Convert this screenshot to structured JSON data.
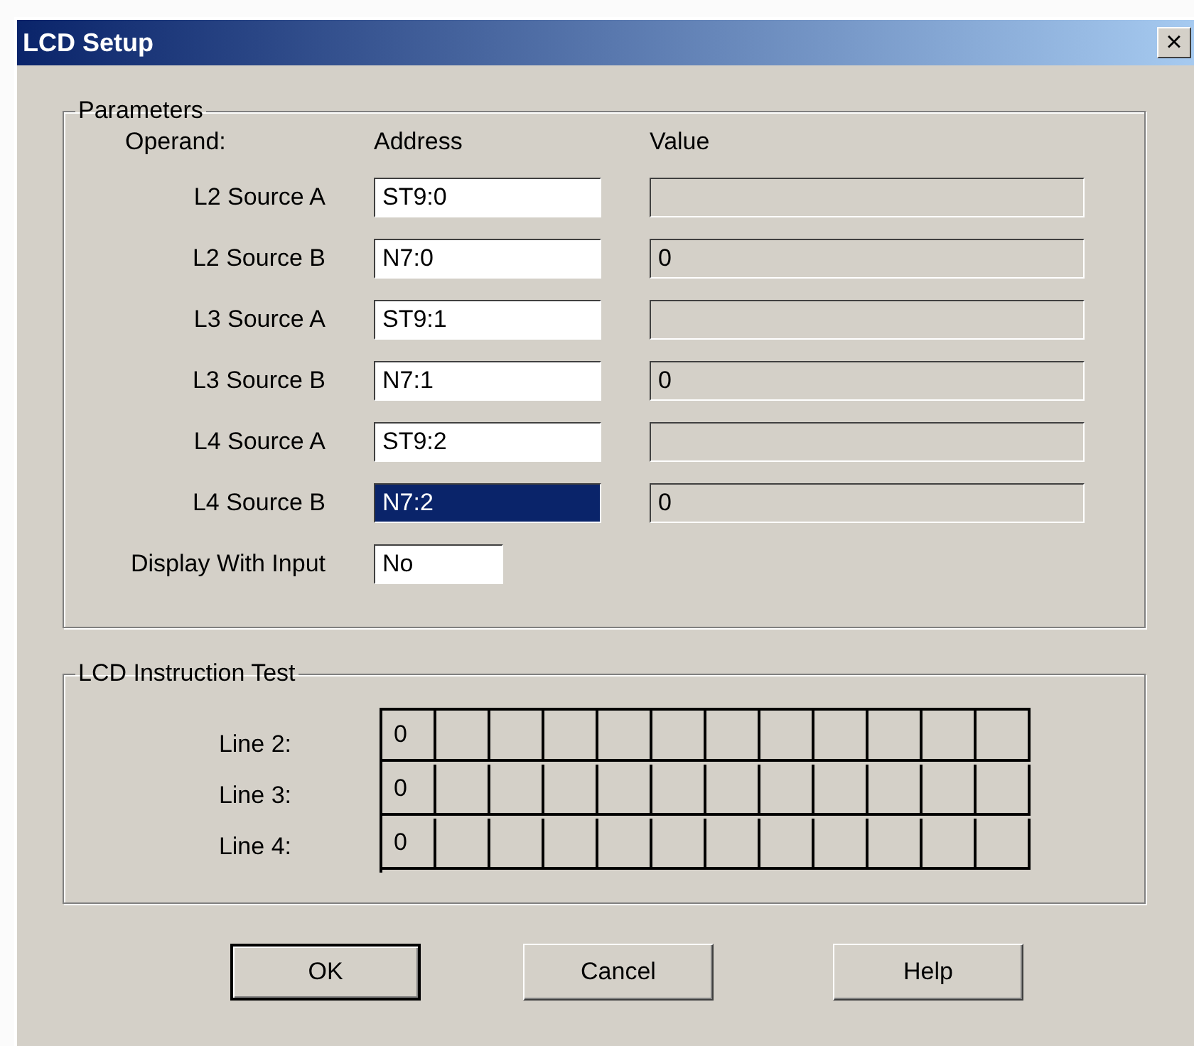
{
  "window": {
    "title": "LCD Setup",
    "close": "×"
  },
  "parameters": {
    "label": "Parameters",
    "headers": [
      "Operand:",
      "Address",
      "Value"
    ],
    "rows": [
      {
        "operand": "L2 Source A",
        "address": "ST9:0",
        "selected": false
      },
      {
        "operand": "L2 Source B",
        "address": "N7:0",
        "value": "0",
        "selected": false
      },
      {
        "operand": "L3 Source A",
        "address": "ST9:1",
        "selected": false
      },
      {
        "operand": "L3 Source B",
        "address": "N7:1",
        "value": "0",
        "selected": false
      },
      {
        "operand": "L4 Source A",
        "address": "ST9:2",
        "selected": false
      },
      {
        "operand": "L4 Source B",
        "address": "N7:2",
        "value": "0",
        "selected": true
      }
    ],
    "display_with_input": {
      "label": "Display With Input",
      "value": "No"
    }
  },
  "lcd_test": {
    "label": "LCD Instruction Test",
    "lines": [
      {
        "label": "Line 2:",
        "first_cell": "0"
      },
      {
        "label": "Line 3:",
        "first_cell": "0"
      },
      {
        "label": "Line 4:",
        "first_cell": "0"
      }
    ]
  },
  "buttons": [
    {
      "label": "OK",
      "default": true
    },
    {
      "label": "Cancel",
      "default": false
    },
    {
      "label": "Help",
      "default": false
    }
  ]
}
